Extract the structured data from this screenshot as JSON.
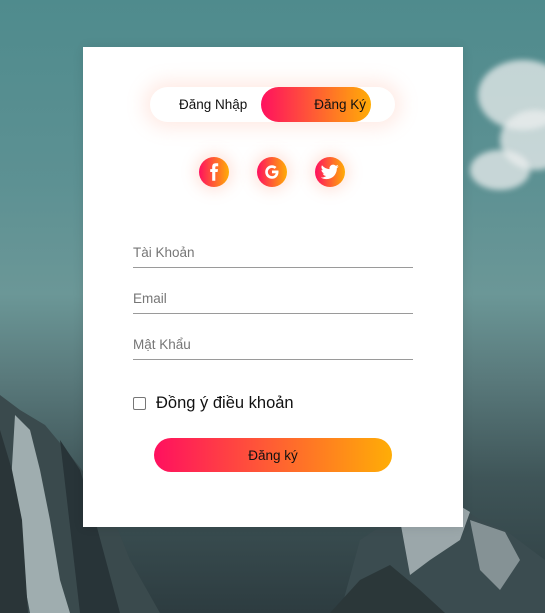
{
  "toggle": {
    "login_label": "Đăng Nhập",
    "register_label": "Đăng Ký",
    "active": "register"
  },
  "social": {
    "facebook_icon": "facebook-icon",
    "google_icon": "google-icon",
    "twitter_icon": "twitter-icon"
  },
  "form": {
    "username_placeholder": "Tài Khoản",
    "email_placeholder": "Email",
    "password_placeholder": "Mật Khẩu",
    "agree_label": "Đồng ý điều khoản",
    "agree_checked": false,
    "submit_label": "Đăng ký"
  },
  "colors": {
    "gradient_start": "#ff105f",
    "gradient_end": "#ffad06",
    "card_background": "#ffffff"
  }
}
